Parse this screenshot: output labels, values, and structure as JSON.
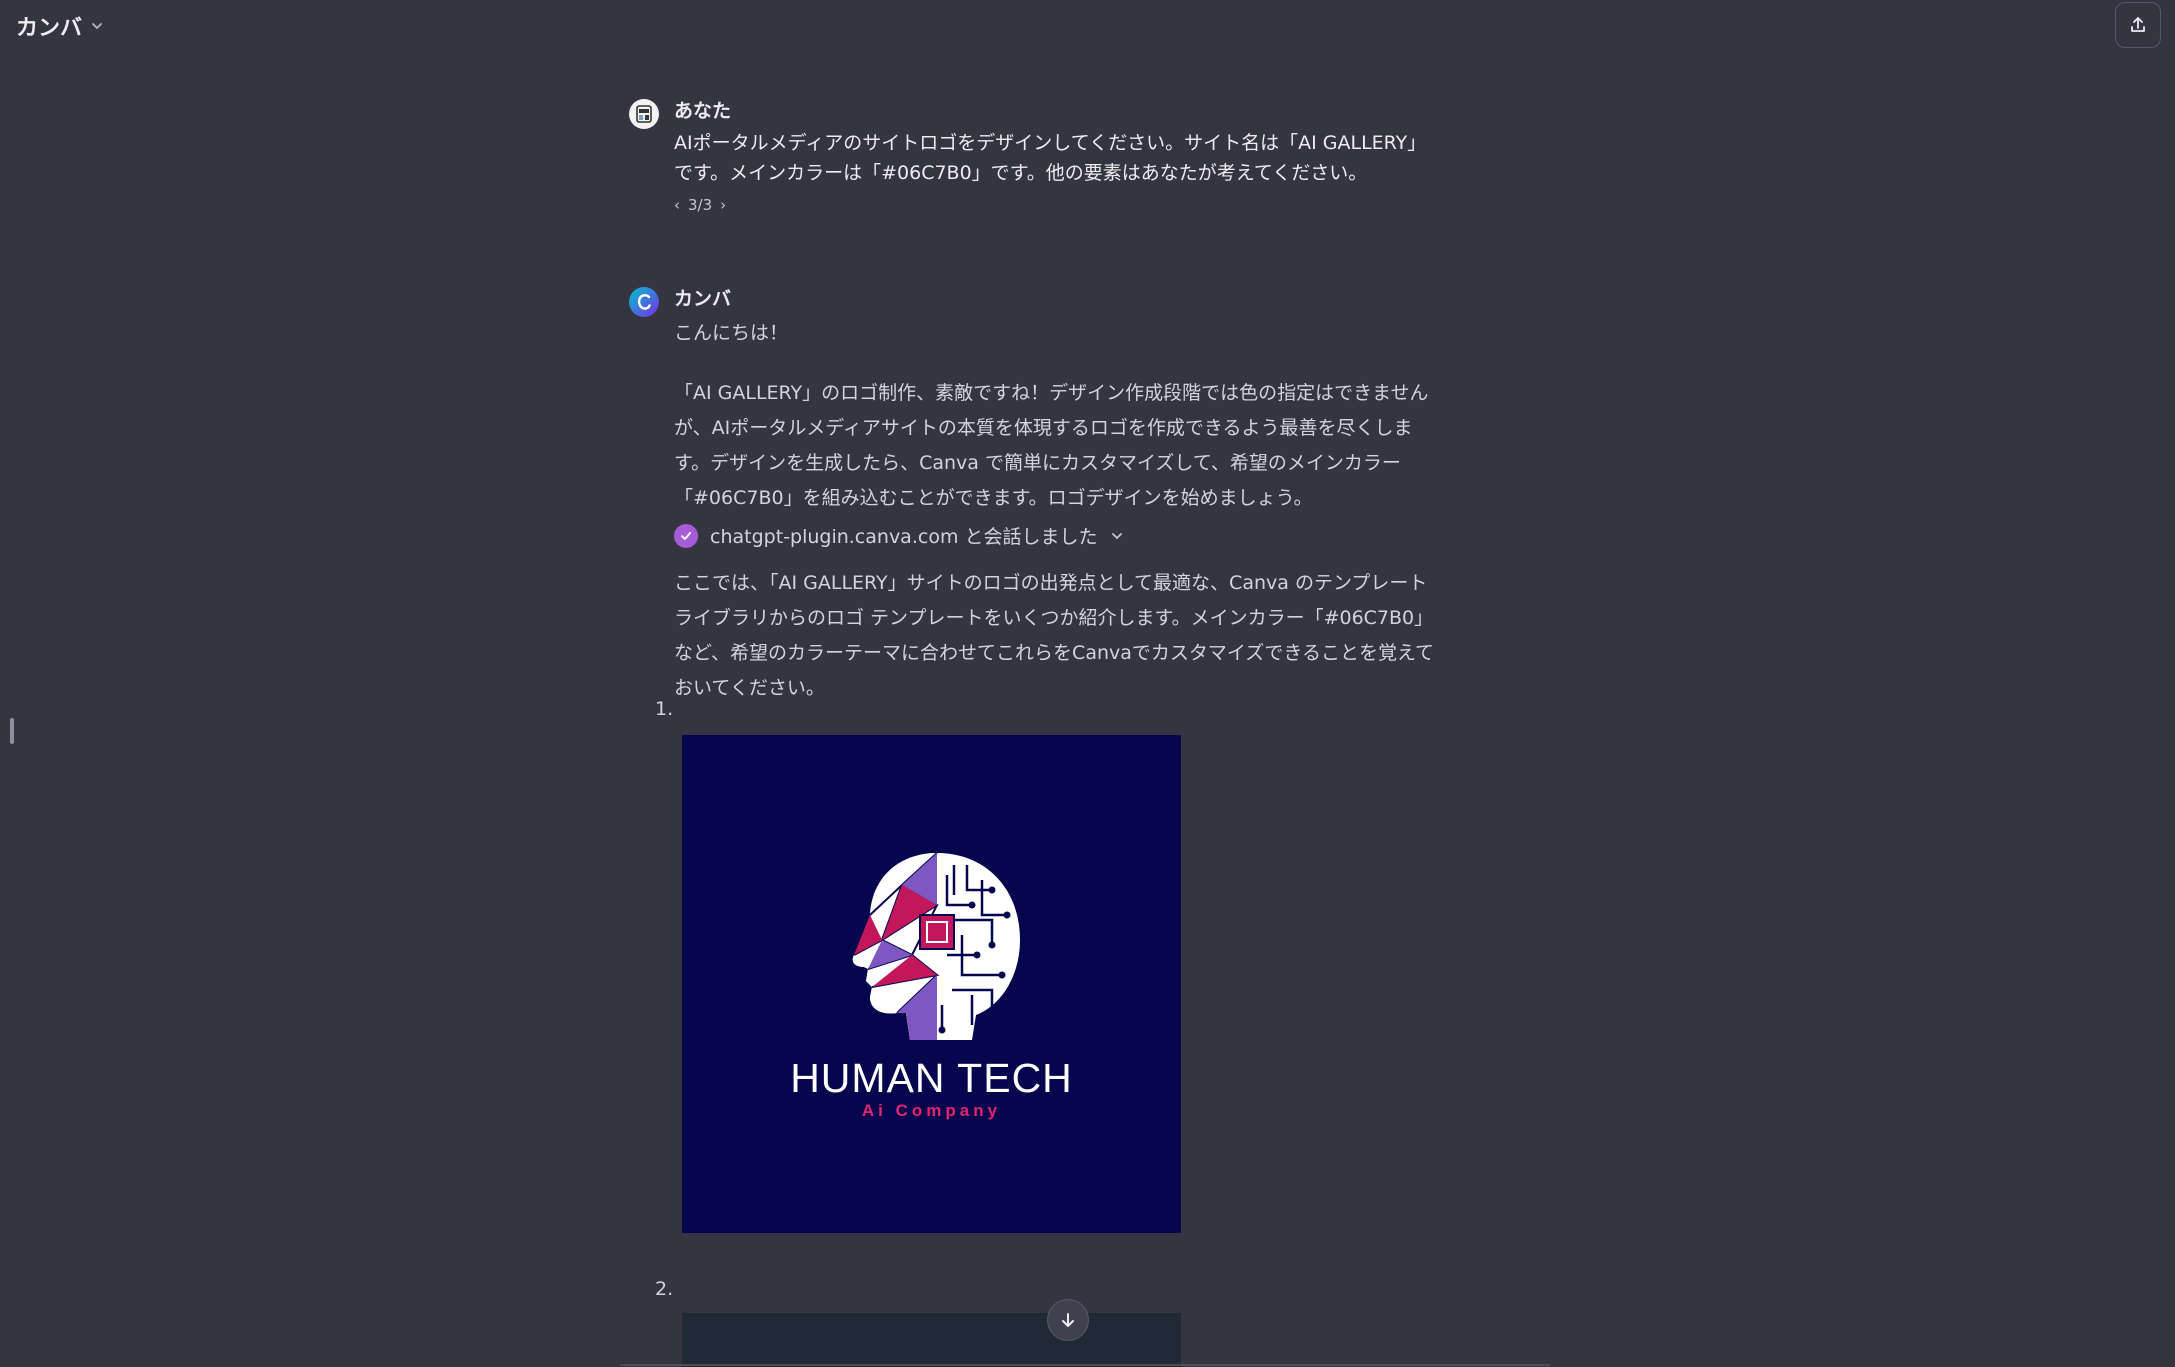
{
  "header": {
    "model_name": "カンバ"
  },
  "user_message": {
    "author": "あなた",
    "text": "AIポータルメディアのサイトロゴをデザインしてください。サイト名は「AI GALLERY」です。メインカラーは「#06C7B0」です。他の要素はあなたが考えてください。",
    "pager": "3/3"
  },
  "bot_message": {
    "author": "カンバ",
    "greeting": "こんにちは！",
    "paragraph1": "「AI GALLERY」のロゴ制作、素敵ですね！デザイン作成段階では色の指定はできませんが、AIポータルメディアサイトの本質を体現するロゴを作成できるよう最善を尽くします。デザインを生成したら、Canva で簡単にカスタマイズして、希望のメインカラー「#06C7B0」を組み込むことができます。ロゴデザインを始めましょう。",
    "plugin_status": "chatgpt-plugin.canva.com と会話しました",
    "paragraph2": "ここでは、「AI GALLERY」サイトのロゴの出発点として最適な、Canva のテンプレート ライブラリからのロゴ テンプレートをいくつか紹介します。メインカラー「#06C7B0」など、希望のカラーテーマに合わせてこれらをCanvaでカスタマイズできることを覚えておいてください。",
    "list": [
      {
        "number": "1.",
        "logo_title": "HUMAN TECH",
        "logo_subtitle": "Ai Company"
      },
      {
        "number": "2."
      }
    ]
  },
  "colors": {
    "background": "#343541",
    "logo_bg": "#06064f",
    "accent_pink": "#e0266f",
    "plugin_check": "#a65cd6"
  }
}
